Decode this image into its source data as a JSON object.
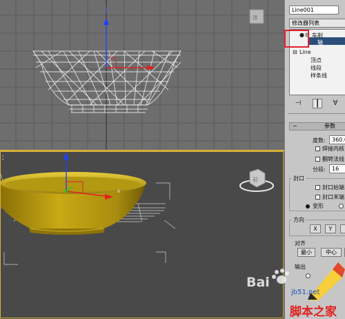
{
  "viewports": {
    "perspective_label": "："
  },
  "command_panel": {
    "object_name": "Line001",
    "modifier_list": "修改器列表",
    "stack": {
      "lathe": "车削",
      "axis": "轴",
      "line": "Line",
      "vertex": "顶点",
      "segment": "线段",
      "spline": "样条线"
    },
    "parameters": {
      "title": "参数",
      "degrees_label": "度数:",
      "degrees_value": "360.0",
      "weld_core": "焊接内核",
      "flip_normals": "翻转法线",
      "segments_label": "分段:",
      "segments_value": "16",
      "capping_title": "封口",
      "cap_start": "封口始端",
      "cap_end": "封口末端",
      "morph": "变形",
      "direction_title": "方向",
      "dir_x": "X",
      "dir_y": "Y",
      "align_title": "对齐",
      "align_min": "最小",
      "align_center": "中心",
      "output_title": "输出"
    }
  },
  "watermarks": {
    "baidu": "Bai",
    "jb51": "jb51.net",
    "site": "脚本之家"
  },
  "colors": {
    "highlight_box": "#e3202a",
    "bowl": "#b49a12",
    "viewport_active_border": "#d8b334"
  }
}
